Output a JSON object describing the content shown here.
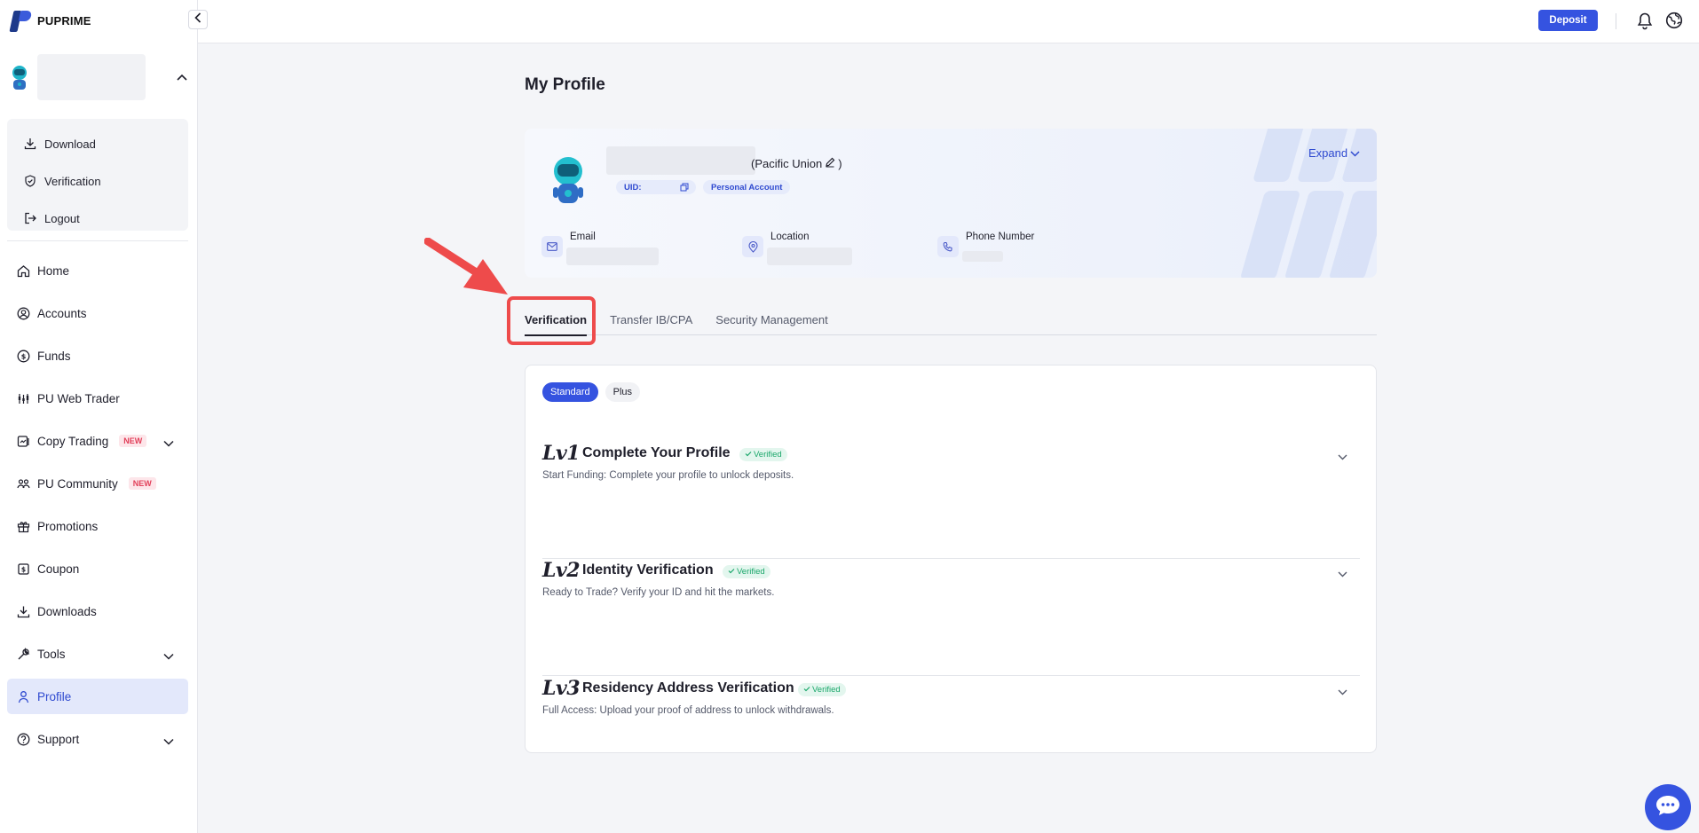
{
  "brand": {
    "name": "PUPRIME"
  },
  "user_menu": [
    {
      "label": "Download",
      "icon": "download-icon"
    },
    {
      "label": "Verification",
      "icon": "shield-check-icon"
    },
    {
      "label": "Logout",
      "icon": "logout-icon"
    }
  ],
  "nav": [
    {
      "label": "Home",
      "icon": "home-icon"
    },
    {
      "label": "Accounts",
      "icon": "user-circle-icon"
    },
    {
      "label": "Funds",
      "icon": "dollar-circle-icon"
    },
    {
      "label": "PU Web Trader",
      "icon": "chart-icon"
    },
    {
      "label": "Copy Trading",
      "icon": "copy-trading-icon",
      "badge": "NEW",
      "has_chevron": true
    },
    {
      "label": "PU Community",
      "icon": "community-icon",
      "badge": "NEW"
    },
    {
      "label": "Promotions",
      "icon": "gift-icon"
    },
    {
      "label": "Coupon",
      "icon": "coupon-icon"
    },
    {
      "label": "Downloads",
      "icon": "download-icon"
    },
    {
      "label": "Tools",
      "icon": "wrench-icon",
      "has_chevron": true
    },
    {
      "label": "Profile",
      "icon": "person-icon",
      "active": true
    },
    {
      "label": "Support",
      "icon": "help-icon",
      "has_chevron": true
    }
  ],
  "topbar": {
    "deposit_label": "Deposit"
  },
  "page": {
    "title": "My Profile"
  },
  "profile": {
    "name_suffix": "(Pacific Union",
    "name_suffix_end": ")",
    "uid_label": "UID:",
    "account_type": "Personal Account",
    "expand_label": "Expand",
    "info": {
      "email_label": "Email",
      "location_label": "Location",
      "phone_label": "Phone Number"
    }
  },
  "tabs": [
    {
      "label": "Verification",
      "active": true
    },
    {
      "label": "Transfer IB/CPA",
      "active": false
    },
    {
      "label": "Security Management",
      "active": false
    }
  ],
  "verification": {
    "segments": [
      {
        "label": "Standard",
        "active": true
      },
      {
        "label": "Plus",
        "active": false
      }
    ],
    "levels": [
      {
        "lv": "Lv1",
        "title": "Complete Your Profile",
        "status": "Verified",
        "desc": "Start Funding: Complete your profile to unlock deposits."
      },
      {
        "lv": "Lv2",
        "title": "Identity Verification",
        "status": "Verified",
        "desc": "Ready to Trade? Verify your ID and hit the markets."
      },
      {
        "lv": "Lv3",
        "title": "Residency Address Verification",
        "status": "Verified",
        "desc": "Full Access: Upload your proof of address to unlock withdrawals."
      }
    ]
  },
  "colors": {
    "accent": "#3553e0",
    "verified_green": "#1aa76a",
    "new_badge": "#e2405a",
    "highlight_red": "#ee4b4b"
  }
}
